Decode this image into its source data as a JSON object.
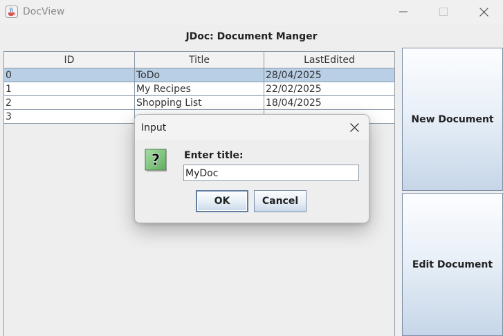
{
  "window": {
    "title": "DocView",
    "icon": "java-coffee-cup-icon",
    "controls": [
      "minimize-icon",
      "maximize-icon",
      "close-icon"
    ]
  },
  "header": {
    "title": "JDoc: Document Manger"
  },
  "table": {
    "columns": [
      "ID",
      "Title",
      "LastEdited"
    ],
    "rows": [
      {
        "id": "0",
        "title": "ToDo",
        "last_edited": "28/04/2025",
        "selected": true
      },
      {
        "id": "1",
        "title": "My Recipes",
        "last_edited": "22/02/2025",
        "selected": false
      },
      {
        "id": "2",
        "title": "Shopping List",
        "last_edited": "18/04/2025",
        "selected": false
      },
      {
        "id": "3",
        "title": "",
        "last_edited": "",
        "selected": false
      }
    ]
  },
  "actions": {
    "new_document": "New Document",
    "edit_document": "Edit Document"
  },
  "dialog": {
    "title": "Input",
    "icon": "question-icon",
    "prompt": "Enter title:",
    "input_value": "MyDoc",
    "ok_label": "OK",
    "cancel_label": "Cancel"
  },
  "colors": {
    "selection": "#b8cfe5",
    "border": "#8a98a8",
    "question_icon_bg": "#7cc37c"
  }
}
